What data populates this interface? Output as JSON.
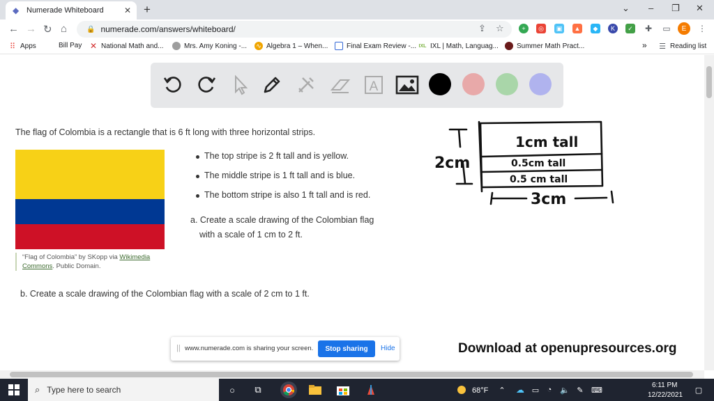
{
  "browser": {
    "tab_title": "Numerade Whiteboard",
    "tab_close": "✕",
    "new_tab": "+",
    "url": "numerade.com/answers/whiteboard/",
    "profile_initial": "E",
    "window_controls": [
      "–",
      "❐",
      "✕"
    ]
  },
  "bookmarks": {
    "items": [
      {
        "label": "Apps",
        "icon": "apps-grid-icon",
        "color": "#e8453c"
      },
      {
        "label": "Bill Pay",
        "icon": "blank-icon",
        "color": "#ffffff"
      },
      {
        "label": "National Math and...",
        "icon": "x-logo-icon",
        "color": "#d32f2f"
      },
      {
        "label": "Mrs. Amy Koning -...",
        "icon": "globe-icon",
        "color": "#9e9e9e"
      },
      {
        "label": "Algebra 1 – When...",
        "icon": "algebra-icon",
        "color": "#f0a500"
      },
      {
        "label": "Final Exam Review -...",
        "icon": "form-icon",
        "color": "#3367d6"
      },
      {
        "label": "IXL | Math, Languag...",
        "icon": "ixl-icon",
        "color": "#7cb342"
      },
      {
        "label": "Summer Math Pract...",
        "icon": "circle-logo-icon",
        "color": "#6a1b1b"
      }
    ],
    "overflow": "»",
    "reading_list": "Reading list"
  },
  "whiteboard": {
    "tools": [
      "undo-icon",
      "redo-icon",
      "pointer-icon",
      "pen-icon",
      "tools-icon",
      "eraser-icon",
      "text-icon",
      "image-icon"
    ],
    "text_tool_glyph": "A",
    "colors": [
      "#000000",
      "#e8a9a9",
      "#a9d6a9",
      "#b0b3ee"
    ]
  },
  "problem": {
    "intro": "The flag of Colombia is a rectangle that is 6 ft long with three horizontal strips.",
    "bullets": [
      "The top stripe is 2 ft tall and is yellow.",
      "The middle stripe is 1 ft tall and is blue.",
      "The bottom stripe is also 1 ft tall and is red."
    ],
    "part_a_line1": "a. Create a scale drawing of the Colombian flag",
    "part_a_line2": "with a scale of 1 cm to 2 ft.",
    "part_b": "b. Create a scale drawing of the Colombian flag with a scale of 2 cm to 1 ft.",
    "credit_before": "“Flag of Colombia” by SKopp via ",
    "credit_link1": "Wikimedia",
    "credit_link2": "Commons",
    "credit_after": ". Public Domain.",
    "flag_colors": {
      "yellow": "#f7d117",
      "blue": "#003893",
      "red": "#ce1126"
    }
  },
  "handwriting": {
    "left_dim": "2cm",
    "top_stripe": "1cm tall",
    "middle_stripe": "0.5cm tall",
    "bottom_stripe": "0.5 cm tall",
    "bottom_dim": "3cm"
  },
  "share_bar": {
    "grip": "||",
    "message": "www.numerade.com is sharing your screen.",
    "stop_label": "Stop sharing",
    "hide_label": "Hide"
  },
  "watermark": "Download at openupresources.org",
  "taskbar": {
    "search_placeholder": "Type here to search",
    "weather": "68°F",
    "time": "6:11 PM",
    "date": "12/22/2021"
  }
}
